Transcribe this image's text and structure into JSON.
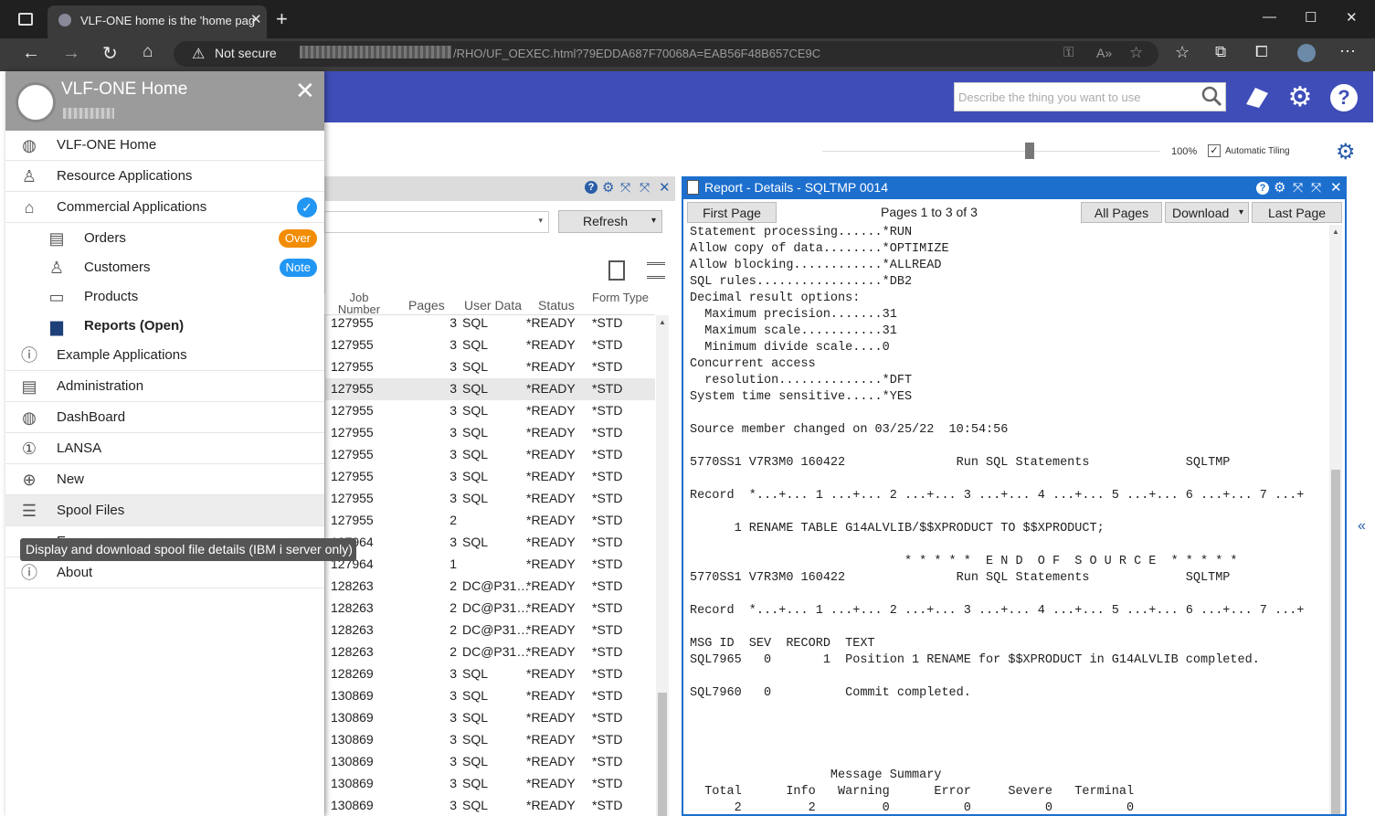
{
  "browser": {
    "tab_title": "VLF-ONE home is the 'home pag",
    "not_secure": "Not secure",
    "url": "/RHO/UF_OEXEC.html?79EDDA687F70068A=EAB56F48B657CE9C",
    "new_tab": "+",
    "window_controls": [
      "—",
      "☐",
      "✕"
    ]
  },
  "header": {
    "search_placeholder": "Describe the thing you want to use",
    "zoom": "100%",
    "auto_tiling": "Automatic Tiling"
  },
  "menu": {
    "title": "VLF-ONE Home",
    "items": [
      {
        "label": "VLF-ONE Home",
        "icon": "globe-icon"
      },
      {
        "label": "Resource Applications",
        "icon": "person-icon"
      },
      {
        "label": "Commercial Applications",
        "icon": "factory-icon"
      },
      {
        "label": "Orders",
        "icon": "clipboard-icon",
        "badge": "Over"
      },
      {
        "label": "Customers",
        "icon": "people-icon",
        "badge": "Note"
      },
      {
        "label": "Products",
        "icon": "window-icon"
      },
      {
        "label": "Reports (Open)",
        "icon": "document-icon"
      },
      {
        "label": "Example Applications",
        "icon": "info-icon"
      },
      {
        "label": "Administration",
        "icon": "clipboard-icon"
      },
      {
        "label": "DashBoard",
        "icon": "globe-icon"
      },
      {
        "label": "LANSA",
        "icon": "number-one-icon"
      },
      {
        "label": "New",
        "icon": "plus-circle-icon"
      },
      {
        "label": "Spool Files",
        "icon": "list-icon"
      },
      {
        "label": "About",
        "icon": "info-icon"
      }
    ],
    "partial_item": "E...",
    "tooltip": "Display and download spool file details (IBM i server only)"
  },
  "spool": {
    "refresh": "Refresh",
    "columns": [
      "Job Number",
      "Pages",
      "User Data",
      "Status",
      "Form Type"
    ],
    "rows": [
      [
        "127955",
        "3",
        "SQL",
        "*READY",
        "*STD"
      ],
      [
        "127955",
        "3",
        "SQL",
        "*READY",
        "*STD"
      ],
      [
        "127955",
        "3",
        "SQL",
        "*READY",
        "*STD"
      ],
      [
        "127955",
        "3",
        "SQL",
        "*READY",
        "*STD"
      ],
      [
        "127955",
        "3",
        "SQL",
        "*READY",
        "*STD"
      ],
      [
        "127955",
        "3",
        "SQL",
        "*READY",
        "*STD"
      ],
      [
        "127955",
        "3",
        "SQL",
        "*READY",
        "*STD"
      ],
      [
        "127955",
        "3",
        "SQL",
        "*READY",
        "*STD"
      ],
      [
        "127955",
        "3",
        "SQL",
        "*READY",
        "*STD"
      ],
      [
        "127955",
        "2",
        "",
        "*READY",
        "*STD"
      ],
      [
        "127964",
        "3",
        "SQL",
        "*READY",
        "*STD"
      ],
      [
        "127964",
        "1",
        "",
        "*READY",
        "*STD"
      ],
      [
        "128263",
        "2",
        "DC@P31…",
        "*READY",
        "*STD"
      ],
      [
        "128263",
        "2",
        "DC@P31…",
        "*READY",
        "*STD"
      ],
      [
        "128263",
        "2",
        "DC@P31…",
        "*READY",
        "*STD"
      ],
      [
        "128263",
        "2",
        "DC@P31…",
        "*READY",
        "*STD"
      ],
      [
        "128269",
        "3",
        "SQL",
        "*READY",
        "*STD"
      ],
      [
        "130869",
        "3",
        "SQL",
        "*READY",
        "*STD"
      ],
      [
        "130869",
        "3",
        "SQL",
        "*READY",
        "*STD"
      ],
      [
        "130869",
        "3",
        "SQL",
        "*READY",
        "*STD"
      ],
      [
        "130869",
        "3",
        "SQL",
        "*READY",
        "*STD"
      ],
      [
        "130869",
        "3",
        "SQL",
        "*READY",
        "*STD"
      ],
      [
        "130869",
        "3",
        "SQL",
        "*READY",
        "*STD"
      ]
    ]
  },
  "report": {
    "title": "Report - Details - SQLTMP 0014",
    "first_page": "First Page",
    "pages": "Pages 1 to 3 of 3",
    "all_pages": "All Pages",
    "download": "Download",
    "last_page": "Last Page",
    "text": "Statement processing......*RUN\nAllow copy of data........*OPTIMIZE\nAllow blocking............*ALLREAD\nSQL rules.................*DB2\nDecimal result options:\n  Maximum precision.......31\n  Maximum scale...........31\n  Minimum divide scale....0\nConcurrent access\n  resolution..............*DFT\nSystem time sensitive.....*YES\n\nSource member changed on 03/25/22  10:54:56\n\n5770SS1 V7R3M0 160422               Run SQL Statements             SQLTMP\n\nRecord  *...+... 1 ...+... 2 ...+... 3 ...+... 4 ...+... 5 ...+... 6 ...+... 7 ...+\n\n      1 RENAME TABLE G14ALVLIB/$$XPRODUCT TO $$XPRODUCT;\n\n                             * * * * *  E N D  O F  S O U R C E  * * * * *\n5770SS1 V7R3M0 160422               Run SQL Statements             SQLTMP\n\nRecord  *...+... 1 ...+... 2 ...+... 3 ...+... 4 ...+... 5 ...+... 6 ...+... 7 ...+\n\nMSG ID  SEV  RECORD  TEXT\nSQL7965   0       1  Position 1 RENAME for $$XPRODUCT in G14ALVLIB completed.\n\nSQL7960   0          Commit completed.\n\n\n\n\n                   Message Summary\n  Total      Info   Warning      Error     Severe   Terminal\n      2         2         0          0          0          0"
  },
  "colors": {
    "header": "#3f4db8",
    "report_accent": "#1d6fce",
    "badge_over": "#f28c00",
    "badge_note": "#2196f3"
  }
}
